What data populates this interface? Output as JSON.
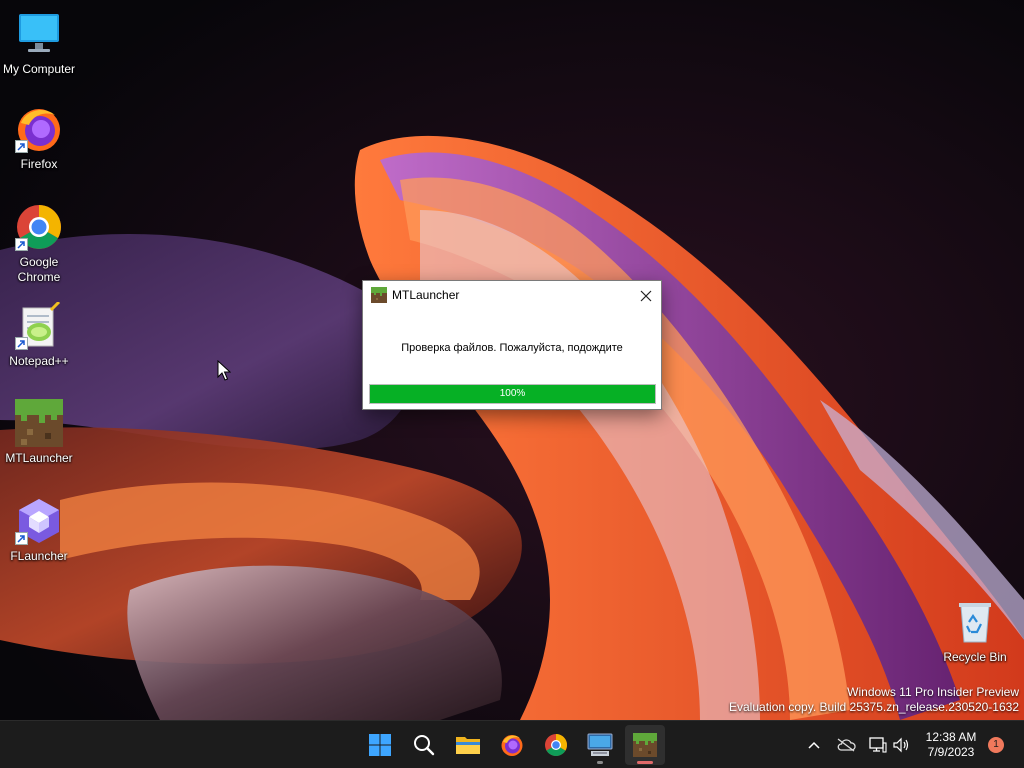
{
  "desktop": {
    "icons": [
      {
        "label": "My Computer",
        "icon": "monitor-icon"
      },
      {
        "label": "Firefox",
        "icon": "firefox-icon"
      },
      {
        "label": "Google Chrome",
        "icon": "chrome-icon"
      },
      {
        "label": "Notepad++",
        "icon": "notepad-plus-plus-icon"
      },
      {
        "label": "MTLauncher",
        "icon": "minecraft-grass-block-icon"
      },
      {
        "label": "FLauncher",
        "icon": "cube-icon"
      },
      {
        "label": "Recycle Bin",
        "icon": "recycle-bin-icon"
      }
    ],
    "watermark": {
      "line1": "Windows 11 Pro Insider Preview",
      "line2": "Evaluation copy. Build 25375.zn_release.230520-1632"
    }
  },
  "dialog": {
    "title": "MTLauncher",
    "message": "Проверка файлов. Пожалуйста, подождите",
    "progress_value": 100,
    "progress_label": "100%",
    "progress_color": "#06b025"
  },
  "taskbar": {
    "apps": [
      {
        "name": "Start",
        "icon": "windows-start-icon"
      },
      {
        "name": "Search",
        "icon": "search-icon"
      },
      {
        "name": "File Explorer",
        "icon": "folder-icon"
      },
      {
        "name": "Firefox",
        "icon": "firefox-icon"
      },
      {
        "name": "Google Chrome",
        "icon": "chrome-icon"
      },
      {
        "name": "Remote Desktop",
        "icon": "keyboard-monitor-icon"
      },
      {
        "name": "MTLauncher",
        "icon": "minecraft-grass-block-icon"
      }
    ],
    "tray": {
      "time": "12:38 AM",
      "date": "7/9/2023",
      "notification_count": "1"
    }
  }
}
